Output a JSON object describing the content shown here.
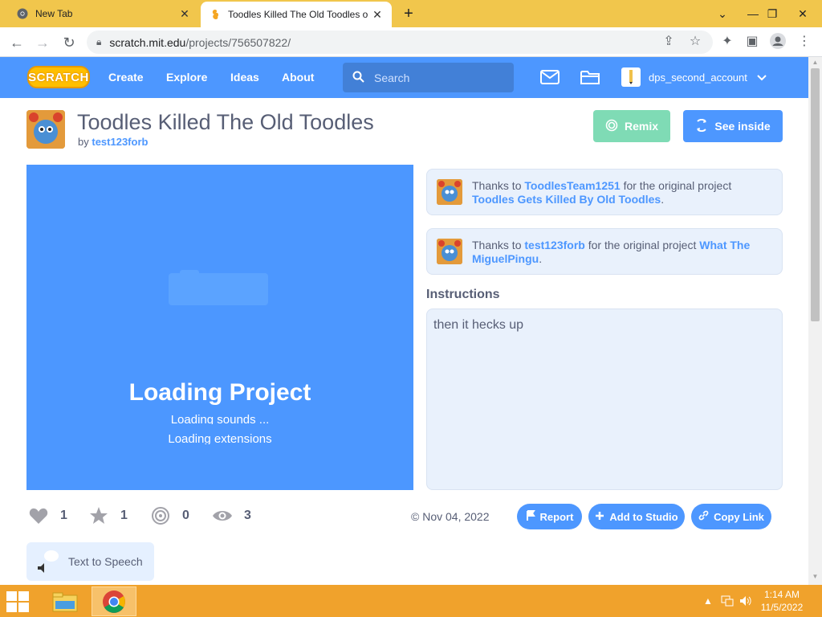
{
  "browser": {
    "tabs": [
      {
        "title": "New Tab",
        "icon": "chrome-icon"
      },
      {
        "title": "Toodles Killed The Old Toodles o",
        "icon": "scratch-icon"
      }
    ],
    "url_host": "scratch.mit.edu",
    "url_path": "/projects/756507822/"
  },
  "nav": {
    "logo": "SCRATCH",
    "links": [
      "Create",
      "Explore",
      "Ideas",
      "About"
    ],
    "search_placeholder": "Search",
    "username": "dps_second_account"
  },
  "project": {
    "title": "Toodles Killed The Old Toodles",
    "by_prefix": "by",
    "author": "test123forb",
    "remix_label": "Remix",
    "see_inside_label": "See inside",
    "loading_title": "Loading Project",
    "loading_messages": [
      "Loading sounds ...",
      "Loading extensions"
    ],
    "credits": [
      {
        "prefix": "Thanks to",
        "user": "ToodlesTeam1251",
        "middle": "for the original project",
        "project": "Toodles Gets Killed By Old Toodles",
        "suffix": "."
      },
      {
        "prefix": "Thanks to",
        "user": "test123forb",
        "middle": "for the original project",
        "project": "What The MiguelPingu",
        "suffix": "."
      }
    ],
    "instructions_heading": "Instructions",
    "instructions": "then it hecks up",
    "stats": {
      "loves": "1",
      "favorites": "1",
      "remixes": "0",
      "views": "3"
    },
    "date": "© Nov 04, 2022",
    "actions": {
      "report": "Report",
      "add_to_studio": "Add to Studio",
      "copy_link": "Copy Link"
    },
    "tts_label": "Text to Speech"
  },
  "taskbar": {
    "time": "1:14 AM",
    "date": "11/5/2022"
  },
  "colors": {
    "scratch_blue": "#4d97ff",
    "remix_green": "#7fdbb5",
    "tab_strip": "#f1c64c",
    "taskbar": "#f0a22c"
  }
}
